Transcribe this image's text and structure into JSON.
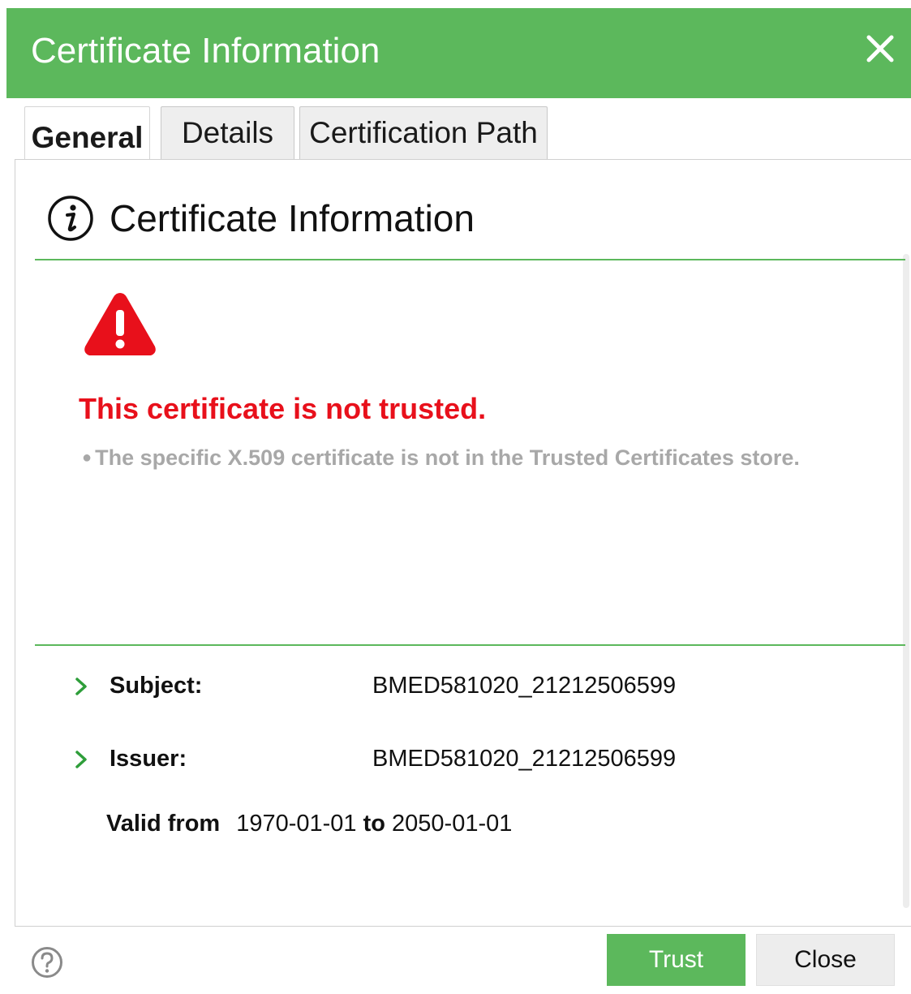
{
  "window": {
    "title": "Certificate Information",
    "accent_color": "#5cb85c",
    "close_icon": "close-icon"
  },
  "tabs": [
    {
      "label": "General",
      "active": true
    },
    {
      "label": "Details",
      "active": false
    },
    {
      "label": "Certification Path",
      "active": false
    }
  ],
  "panel": {
    "heading": "Certificate Information",
    "heading_icon": "info-icon",
    "warning": {
      "icon": "warning-triangle-icon",
      "title": "This certificate is not trusted.",
      "detail": "The specific X.509 certificate is not in the Trusted Certificates store.",
      "title_color": "#e8101b"
    },
    "fields": {
      "subject_label": "Subject:",
      "subject_value": "BMED581020_21212506599",
      "issuer_label": "Issuer:",
      "issuer_value": "BMED581020_21212506599",
      "valid_from_label": "Valid from",
      "valid_from_value": "1970-01-01",
      "valid_to_label": "to",
      "valid_to_value": "2050-01-01"
    }
  },
  "footer": {
    "help_icon": "help-icon",
    "trust_label": "Trust",
    "close_label": "Close"
  }
}
